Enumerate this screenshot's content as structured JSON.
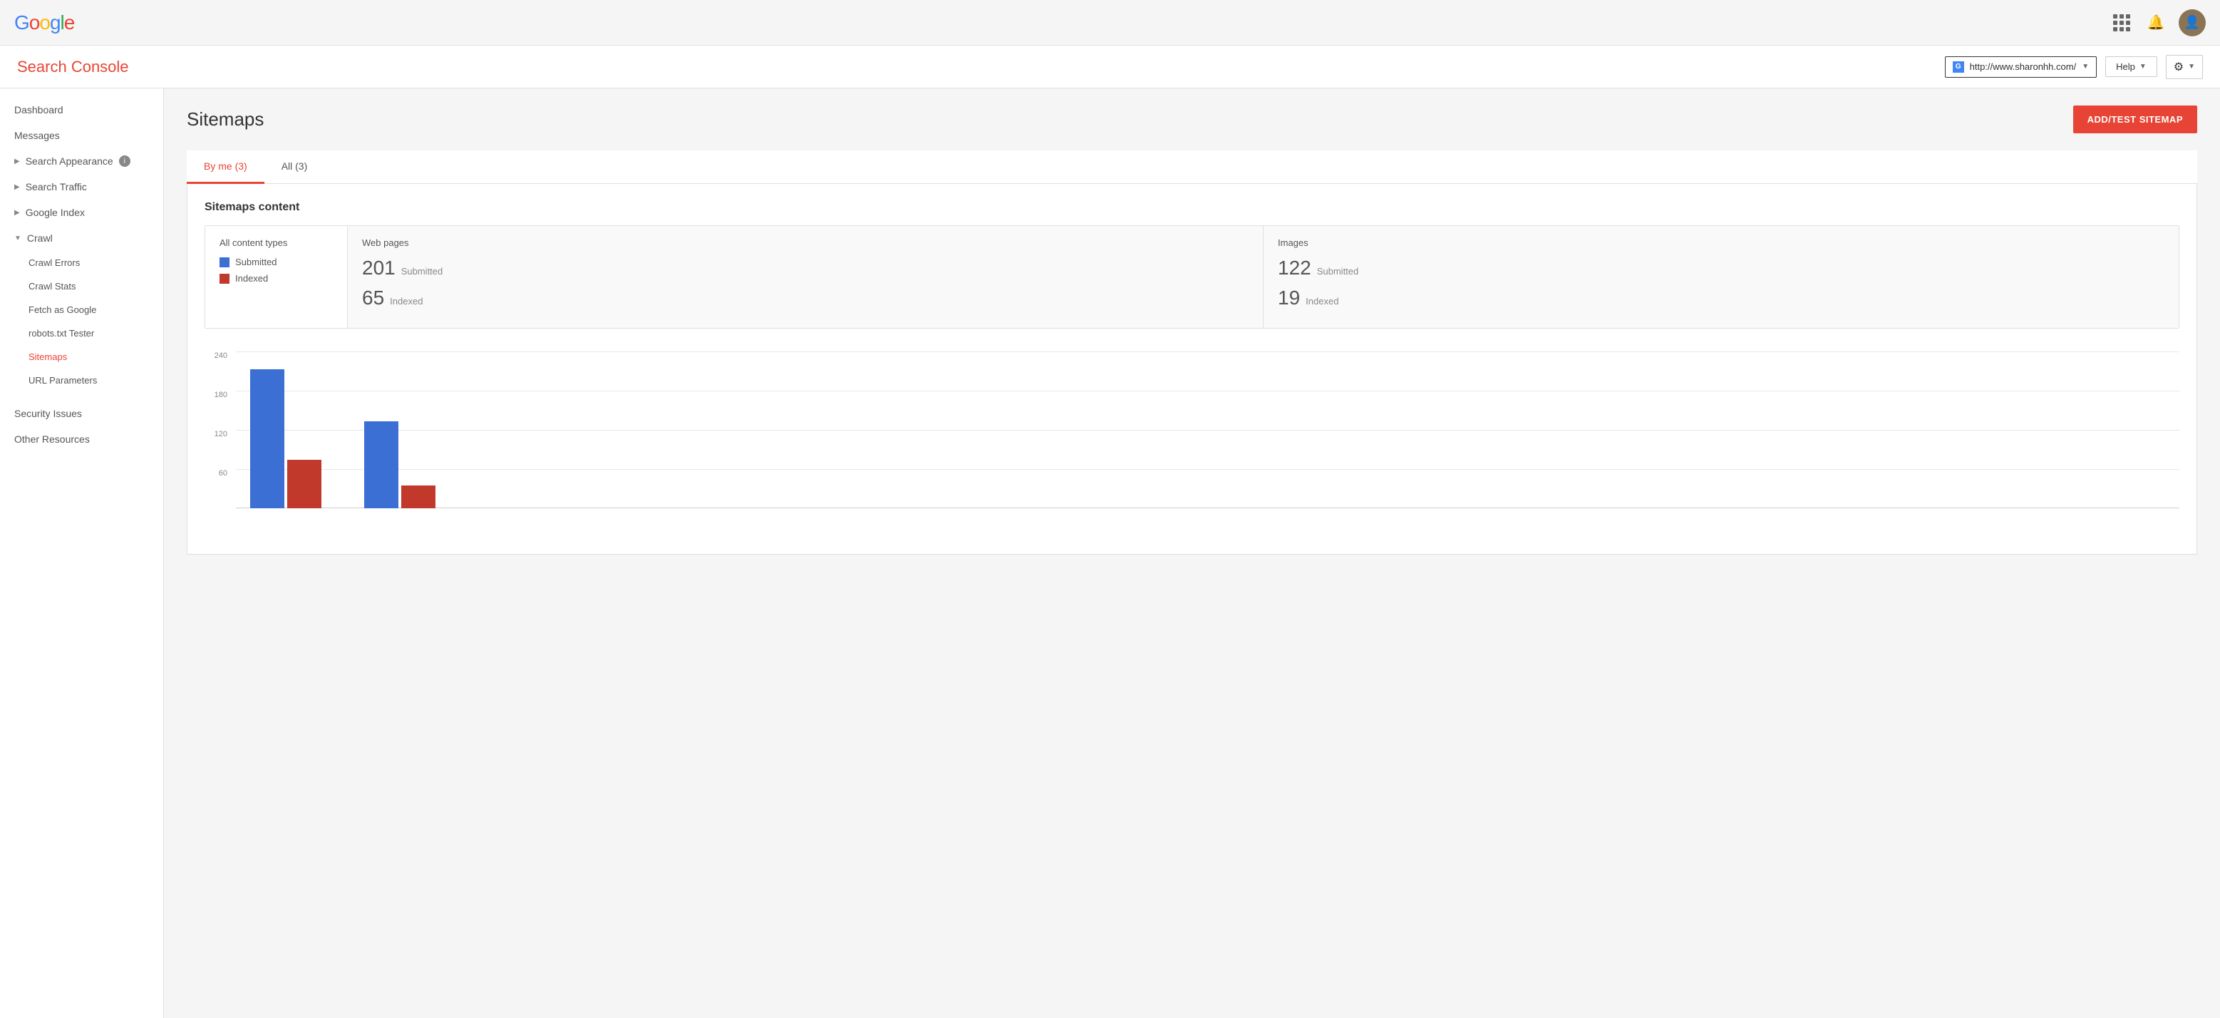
{
  "header": {
    "logo_letters": [
      "G",
      "o",
      "o",
      "g",
      "l",
      "e"
    ],
    "site_url": "http://www.sharonhh.com/",
    "help_label": "Help",
    "gear_symbol": "⚙"
  },
  "sub_header": {
    "title": "Search Console"
  },
  "sidebar": {
    "items": [
      {
        "id": "dashboard",
        "label": "Dashboard",
        "type": "plain"
      },
      {
        "id": "messages",
        "label": "Messages",
        "type": "plain"
      },
      {
        "id": "search-appearance",
        "label": "Search Appearance",
        "type": "expandable",
        "has_info": true
      },
      {
        "id": "search-traffic",
        "label": "Search Traffic",
        "type": "expandable"
      },
      {
        "id": "google-index",
        "label": "Google Index",
        "type": "expandable"
      },
      {
        "id": "crawl",
        "label": "Crawl",
        "type": "expanded"
      }
    ],
    "crawl_sub_items": [
      {
        "id": "crawl-errors",
        "label": "Crawl Errors"
      },
      {
        "id": "crawl-stats",
        "label": "Crawl Stats"
      },
      {
        "id": "fetch-as-google",
        "label": "Fetch as Google"
      },
      {
        "id": "robots-txt",
        "label": "robots.txt Tester"
      },
      {
        "id": "sitemaps",
        "label": "Sitemaps",
        "active": true
      },
      {
        "id": "url-parameters",
        "label": "URL Parameters"
      }
    ],
    "bottom_items": [
      {
        "id": "security-issues",
        "label": "Security Issues"
      },
      {
        "id": "other-resources",
        "label": "Other Resources"
      }
    ]
  },
  "page": {
    "title": "Sitemaps",
    "add_test_btn": "ADD/TEST SITEMAP"
  },
  "tabs": [
    {
      "id": "by-me",
      "label": "By me (3)",
      "active": true
    },
    {
      "id": "all",
      "label": "All (3)",
      "active": false
    }
  ],
  "sitemaps_content": {
    "section_label": "Sitemaps content",
    "all_content_types": "All content types",
    "legend": [
      {
        "id": "submitted",
        "label": "Submitted",
        "color": "blue"
      },
      {
        "id": "indexed",
        "label": "Indexed",
        "color": "red"
      }
    ],
    "web_pages": {
      "title": "Web pages",
      "submitted_count": "201",
      "submitted_label": "Submitted",
      "indexed_count": "65",
      "indexed_label": "Indexed"
    },
    "images": {
      "title": "Images",
      "submitted_count": "122",
      "submitted_label": "Submitted",
      "indexed_count": "19",
      "indexed_label": "Indexed"
    }
  },
  "chart": {
    "y_labels": [
      "240",
      "180",
      "120",
      "60"
    ],
    "bars": [
      {
        "blue_height": 195,
        "red_height": 75
      },
      {
        "blue_height": 130,
        "red_height": 35
      }
    ],
    "max": 240
  }
}
